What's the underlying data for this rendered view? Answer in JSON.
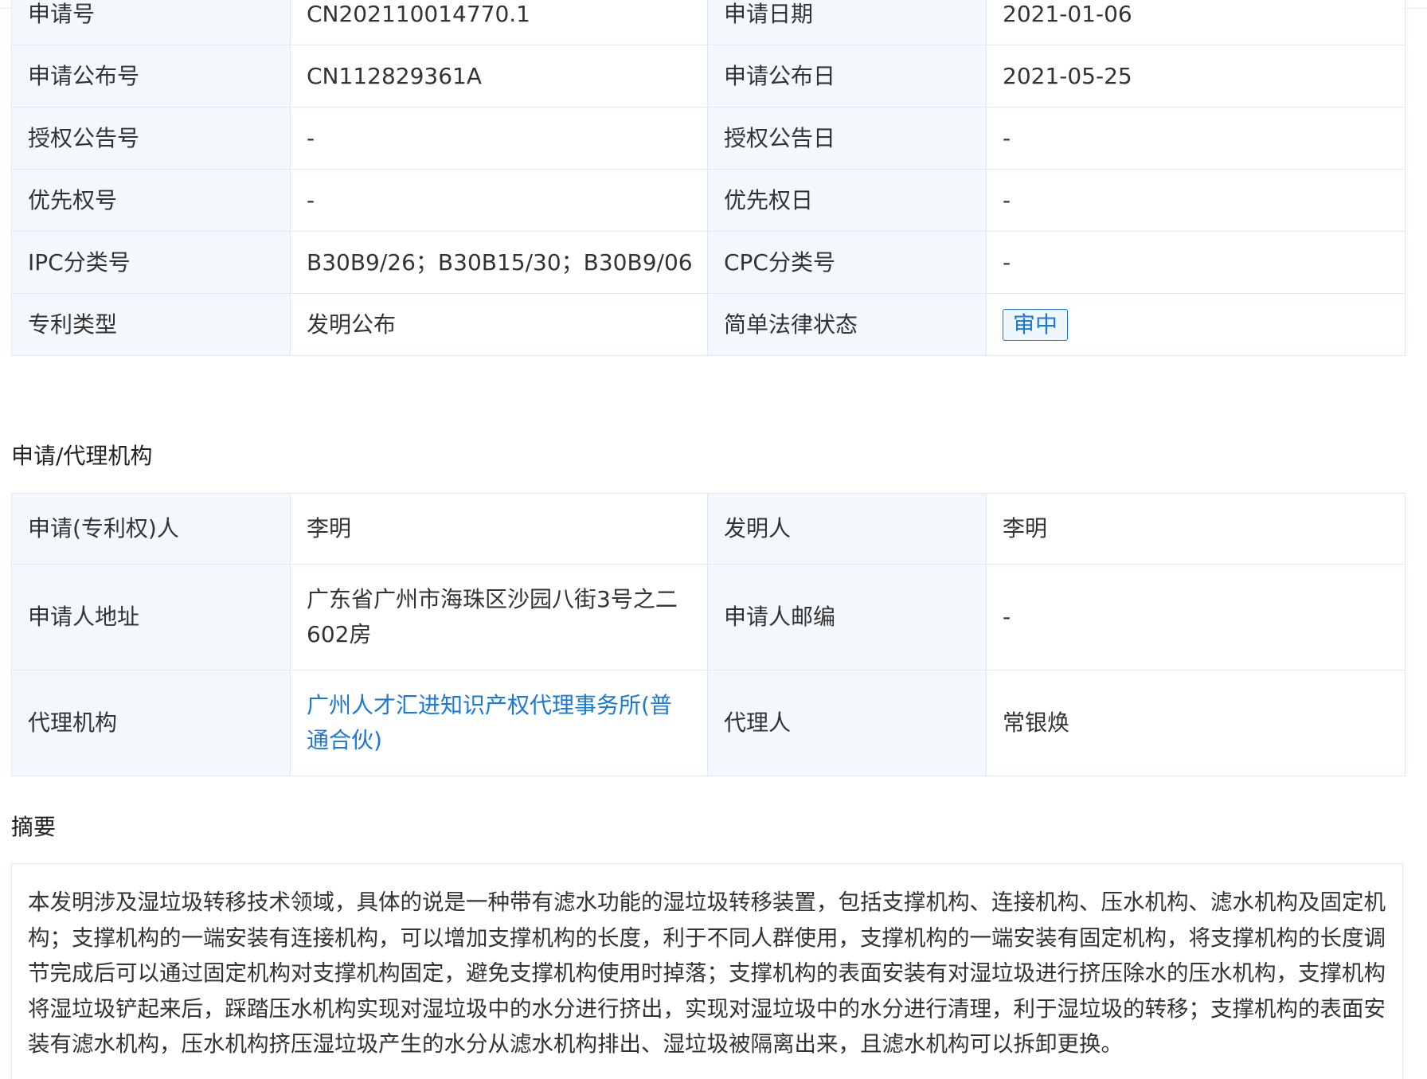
{
  "basic_info": {
    "rows": [
      {
        "label1": "申请号",
        "value1": "CN202110014770.1",
        "label2": "申请日期",
        "value2": "2021-01-06"
      },
      {
        "label1": "申请公布号",
        "value1": "CN112829361A",
        "label2": "申请公布日",
        "value2": "2021-05-25"
      },
      {
        "label1": "授权公告号",
        "value1": "-",
        "label2": "授权公告日",
        "value2": "-"
      },
      {
        "label1": "优先权号",
        "value1": "-",
        "label2": "优先权日",
        "value2": "-"
      },
      {
        "label1": "IPC分类号",
        "value1": "B30B9/26；B30B15/30；B30B9/06",
        "label2": "CPC分类号",
        "value2": "-"
      },
      {
        "label1": "专利类型",
        "value1": "发明公布",
        "label2": "简单法律状态",
        "value2": "审中"
      }
    ]
  },
  "agency_section": {
    "title": "申请/代理机构",
    "rows": [
      {
        "label1": "申请(专利权)人",
        "value1": "李明",
        "label2": "发明人",
        "value2": "李明"
      },
      {
        "label1": "申请人地址",
        "value1": "广东省广州市海珠区沙园八街3号之二602房",
        "label2": "申请人邮编",
        "value2": "-"
      },
      {
        "label1": "代理机构",
        "value1": "广州人才汇进知识产权代理事务所(普通合伙)",
        "label2": "代理人",
        "value2": "常银焕"
      }
    ]
  },
  "abstract_section": {
    "title": "摘要",
    "text": "本发明涉及湿垃圾转移技术领域，具体的说是一种带有滤水功能的湿垃圾转移装置，包括支撑机构、连接机构、压水机构、滤水机构及固定机构；支撑机构的一端安装有连接机构，可以增加支撑机构的长度，利于不同人群使用，支撑机构的一端安装有固定机构，将支撑机构的长度调节完成后可以通过固定机构对支撑机构固定，避免支撑机构使用时掉落；支撑机构的表面安装有对湿垃圾进行挤压除水的压水机构，支撑机构将湿垃圾铲起来后，踩踏压水机构实现对湿垃圾中的水分进行挤出，实现对湿垃圾中的水分进行清理，利于湿垃圾的转移；支撑机构的表面安装有滤水机构，压水机构挤压湿垃圾产生的水分从滤水机构排出、湿垃圾被隔离出来，且滤水机构可以拆卸更换。"
  },
  "colors": {
    "label_bg": "#f3f8fc",
    "border": "#dfe9f3",
    "link": "#1b78d3"
  }
}
